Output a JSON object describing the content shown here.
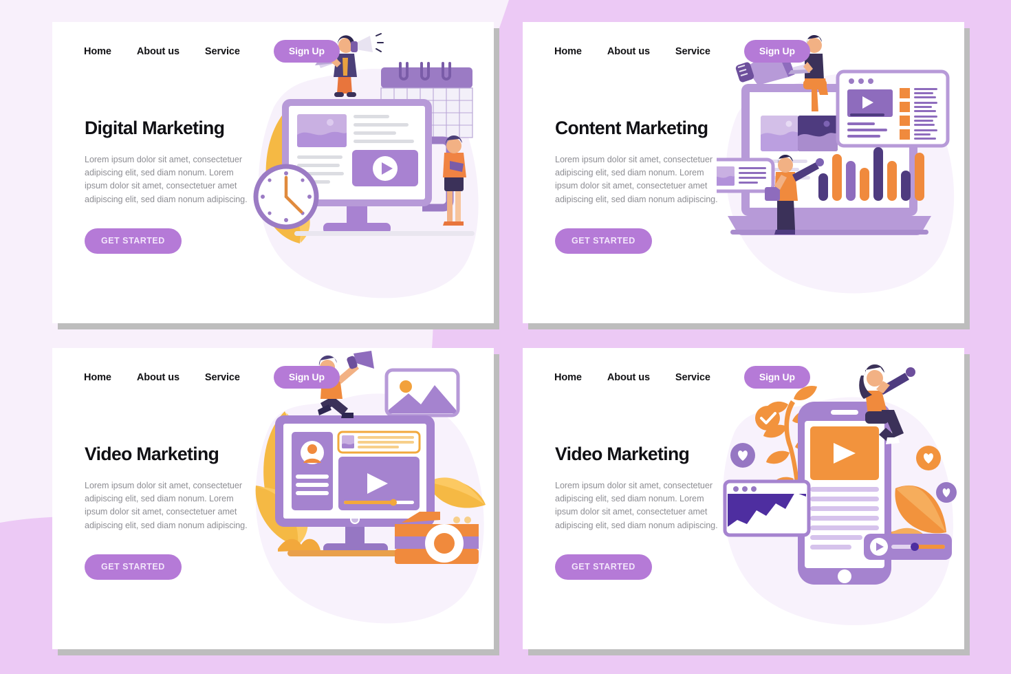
{
  "page": {
    "background_color": "#ecc9f5",
    "background_light_color": "#f8f0fb",
    "card_background": "#ffffff",
    "card_shadow_color": "#bdbdbd",
    "accent_purple": "#b57ad7",
    "heading_color": "#101014",
    "body_text_color": "#8d8d93"
  },
  "nav": {
    "home": "Home",
    "about": "About us",
    "service": "Service",
    "signup": "Sign Up"
  },
  "shared": {
    "paragraph": "Lorem ipsum dolor sit amet, consectetuer adipiscing elit, sed diam nonum. Lorem ipsum dolor sit amet, consectetuer amet adipiscing elit, sed diam nonum adipiscing.",
    "cta": "GET STARTED"
  },
  "cards": [
    {
      "id": "digital-marketing",
      "title": "Digital Marketing",
      "paragraph": "Lorem ipsum dolor sit amet, consectetuer adipiscing elit, sed diam nonum. Lorem ipsum dolor sit amet, consectetuer amet adipiscing elit, sed diam nonum adipiscing.",
      "cta": "GET STARTED",
      "illustration": "monitor-calendar-clock-megaphone"
    },
    {
      "id": "content-marketing",
      "title": "Content Marketing",
      "paragraph": "Lorem ipsum dolor sit amet, consectetuer adipiscing elit, sed diam nonum. Lorem ipsum dolor sit amet, consectetuer amet adipiscing elit, sed diam nonum adipiscing.",
      "cta": "GET STARTED",
      "illustration": "laptop-dashboard-bar-chart-megaphone"
    },
    {
      "id": "video-marketing-left",
      "title": "Video Marketing",
      "paragraph": "Lorem ipsum dolor sit amet, consectetuer adipiscing elit, sed diam nonum. Lorem ipsum dolor sit amet, consectetuer amet adipiscing elit, sed diam nonum adipiscing.",
      "cta": "GET STARTED",
      "illustration": "monitor-video-player-camera-leaves"
    },
    {
      "id": "video-marketing-right",
      "title": "Video Marketing",
      "paragraph": "Lorem ipsum dolor sit amet, consectetuer adipiscing elit, sed diam nonum. Lorem ipsum dolor sit amet, consectetuer amet adipiscing elit, sed diam nonum adipiscing.",
      "cta": "GET STARTED",
      "illustration": "smartphone-video-hearts-chart"
    }
  ]
}
